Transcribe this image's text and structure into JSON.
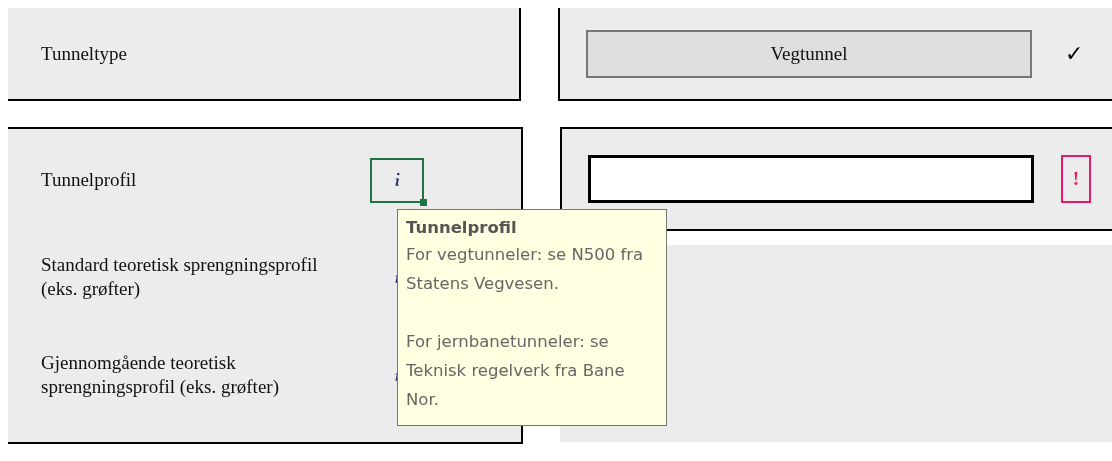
{
  "tunnel_type": {
    "label": "Tunneltype",
    "value": "Vegtunnel",
    "status": {
      "kind": "ok",
      "mark": "✓"
    }
  },
  "tunnel_profile": {
    "label": "Tunnelprofil",
    "info": {
      "selected": true
    },
    "status": {
      "kind": "error",
      "mark": "!"
    }
  },
  "sub_rows": [
    {
      "label": "Standard teoretisk sprengningsprofil (eks. grøfter)",
      "info": {
        "selected": false
      }
    },
    {
      "label": "Gjennomgående teoretisk sprengningsprofil (eks. grøfter)",
      "info": {
        "selected": false
      }
    }
  ],
  "tooltip": {
    "title": "Tunnelprofil",
    "paragraphs": [
      "For vegtunneler: se N500 fra Statens Vegvesen.",
      "For jernbanetunneler: se Teknisk regelverk fra Bane Nor."
    ]
  }
}
